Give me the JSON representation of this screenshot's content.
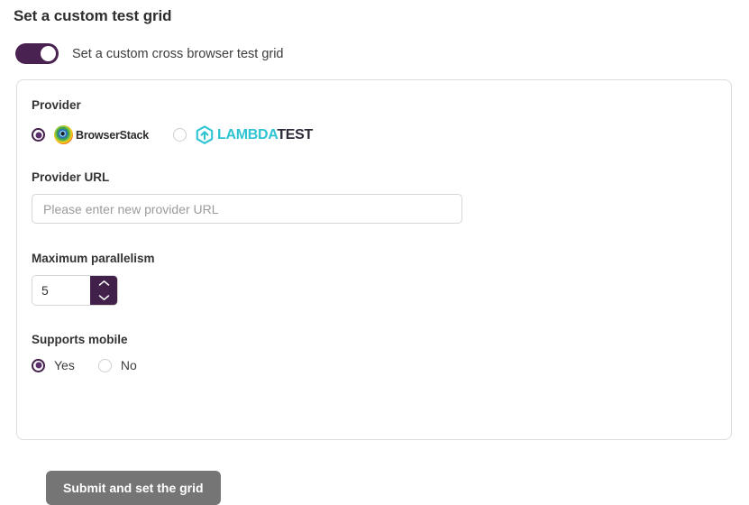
{
  "page": {
    "title": "Set a custom test grid"
  },
  "toggle": {
    "label": "Set a custom cross browser test grid",
    "state": "on",
    "color": "#4a2251"
  },
  "form": {
    "provider": {
      "label": "Provider",
      "selected": "browserstack",
      "options": [
        {
          "id": "browserstack",
          "name": "BrowserStack",
          "selected": true,
          "logo_icon": "browserstack-logo-icon"
        },
        {
          "id": "lambdatest",
          "name_primary": "LAMBDA",
          "name_secondary": "TEST",
          "selected": false,
          "logo_icon": "lambdatest-logo-icon",
          "accent_color": "#2ec4d3"
        }
      ]
    },
    "provider_url": {
      "label": "Provider URL",
      "value": "",
      "placeholder": "Please enter new provider URL"
    },
    "max_parallelism": {
      "label": "Maximum parallelism",
      "value": "5",
      "increment_icon": "chevron-up-icon",
      "decrement_icon": "chevron-down-icon",
      "stepper_color": "#41204a"
    },
    "supports_mobile": {
      "label": "Supports mobile",
      "selected": "yes",
      "options": [
        {
          "id": "yes",
          "label": "Yes",
          "selected": true
        },
        {
          "id": "no",
          "label": "No",
          "selected": false
        }
      ]
    },
    "submit": {
      "label": "Submit and set the grid",
      "color": "#757575"
    }
  }
}
